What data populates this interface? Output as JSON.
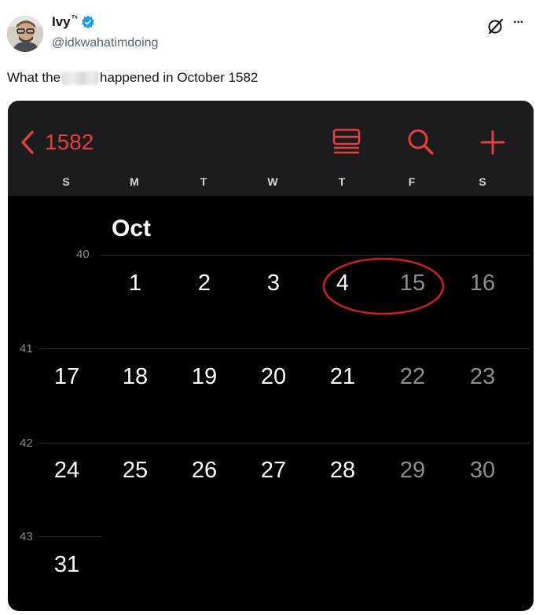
{
  "post": {
    "display_name": "Ivy",
    "name_emoji": "ᵀˢ",
    "handle": "@idkwahatimdoing",
    "text_before": "What the",
    "text_after": "happened in October 1582",
    "more_label": "···"
  },
  "calendar": {
    "year_label": "1582",
    "month_label": "Oct",
    "weekdays": [
      "S",
      "M",
      "T",
      "W",
      "T",
      "F",
      "S"
    ],
    "week_numbers": [
      "40",
      "41",
      "42",
      "43"
    ],
    "weeks": [
      [
        "",
        "1",
        "2",
        "3",
        "4",
        "15",
        "16"
      ],
      [
        "17",
        "18",
        "19",
        "20",
        "21",
        "22",
        "23"
      ],
      [
        "24",
        "25",
        "26",
        "27",
        "28",
        "29",
        "30"
      ],
      [
        "31",
        "",
        "",
        "",
        "",
        "",
        ""
      ]
    ],
    "accent_color": "#e1403e",
    "circled_days": [
      "4",
      "15"
    ]
  },
  "colors": {
    "verified_blue": "#1d9bf0",
    "text_primary": "#0f1419",
    "text_secondary": "#536471"
  }
}
